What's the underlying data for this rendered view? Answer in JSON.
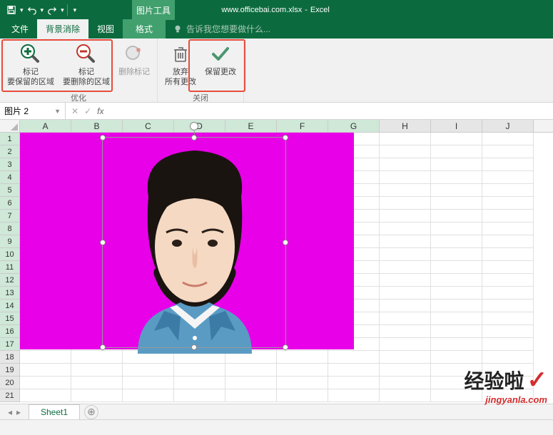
{
  "titlebar": {
    "filename": "www.officebai.com.xlsx",
    "appname": "Excel",
    "contextual_tab": "图片工具"
  },
  "tabs": {
    "file": "文件",
    "bg_remove": "背景消除",
    "view": "视图",
    "format": "格式",
    "tell_me": "告诉我您想要做什么..."
  },
  "ribbon": {
    "mark_keep": {
      "line1": "标记",
      "line2": "要保留的区域"
    },
    "mark_remove": {
      "line1": "标记",
      "line2": "要删除的区域"
    },
    "delete_mark": "删除标记",
    "discard": {
      "line1": "放弃",
      "line2": "所有更改"
    },
    "keep_changes": "保留更改",
    "group_refine": "优化",
    "group_close": "关闭"
  },
  "formula_bar": {
    "name_box": "图片 2",
    "fx": "fx"
  },
  "columns": [
    "A",
    "B",
    "C",
    "D",
    "E",
    "F",
    "G",
    "H",
    "I",
    "J"
  ],
  "rows": [
    1,
    2,
    3,
    4,
    5,
    6,
    7,
    8,
    9,
    10,
    11,
    12,
    13,
    14,
    15,
    16,
    17,
    18,
    19,
    20,
    21
  ],
  "sheet": {
    "name": "Sheet1"
  },
  "watermark": {
    "main": "经验啦",
    "sub": "jingyanla.com"
  }
}
